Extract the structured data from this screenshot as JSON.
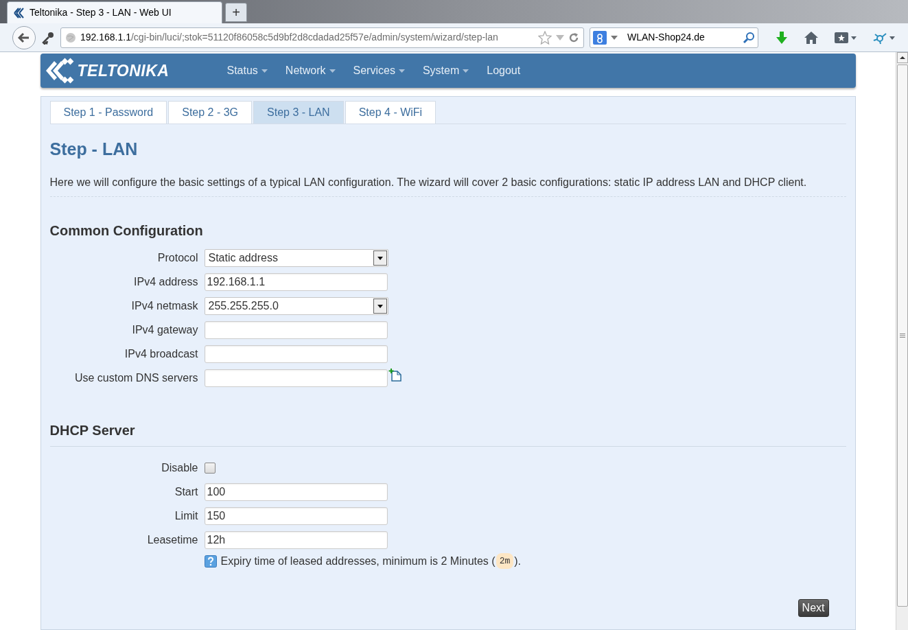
{
  "browser": {
    "tab_title": "Teltonika - Step 3 - LAN - Web UI",
    "new_tab": "+",
    "url_host": "192.168.1.1",
    "url_path": "/cgi-bin/luci/;stok=51120f86058c5d9bf2d8cdadad25f57e/admin/system/wizard/step-lan",
    "search_value": "WLAN-Shop24.de"
  },
  "header": {
    "logo": "TELTONIKA",
    "menu": [
      {
        "label": "Status",
        "dropdown": true
      },
      {
        "label": "Network",
        "dropdown": true
      },
      {
        "label": "Services",
        "dropdown": true
      },
      {
        "label": "System",
        "dropdown": true
      },
      {
        "label": "Logout",
        "dropdown": false
      }
    ]
  },
  "tabs": [
    {
      "label": "Step 1 - Password",
      "selected": false
    },
    {
      "label": "Step 2 - 3G",
      "selected": false
    },
    {
      "label": "Step 3 - LAN",
      "selected": true
    },
    {
      "label": "Step 4 - WiFi",
      "selected": false
    }
  ],
  "title": "Step - LAN",
  "description": "Here we will configure the basic settings of a typical LAN configuration. The wizard will cover 2 basic configurations: static IP address LAN and DHCP client.",
  "sections": [
    {
      "title": "Common Configuration",
      "fields": [
        {
          "kind": "select",
          "label": "Protocol",
          "value": "Static address"
        },
        {
          "kind": "text",
          "label": "IPv4 address",
          "value": "192.168.1.1"
        },
        {
          "kind": "select",
          "label": "IPv4 netmask",
          "value": "255.255.255.0"
        },
        {
          "kind": "text",
          "label": "IPv4 gateway"
        },
        {
          "kind": "text",
          "label": "IPv4 broadcast"
        },
        {
          "kind": "dynlist",
          "label": "Use custom DNS servers"
        }
      ]
    },
    {
      "title": "DHCP Server",
      "fields": [
        {
          "kind": "checkbox",
          "label": "Disable",
          "checked": false
        },
        {
          "kind": "text",
          "label": "Start",
          "value": "100"
        },
        {
          "kind": "text",
          "label": "Limit",
          "value": "150"
        },
        {
          "kind": "text",
          "label": "Leasetime",
          "value": "12h",
          "hint": {
            "before": "Expiry time of leased addresses, minimum is 2 Minutes (",
            "code": "2m",
            "after": ")."
          }
        }
      ]
    }
  ],
  "next_button": "Next"
}
